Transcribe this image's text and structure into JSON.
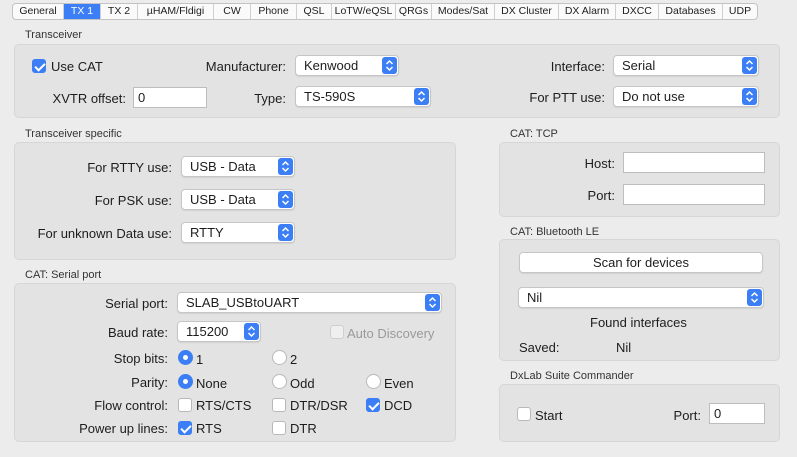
{
  "tabs": [
    "General",
    "TX 1",
    "TX 2",
    "µHAM/Fldigi",
    "CW",
    "Phone",
    "QSL",
    "LoTW/eQSL",
    "QRGs",
    "Modes/Sat",
    "DX Cluster",
    "DX Alarm",
    "DXCC",
    "Databases",
    "UDP"
  ],
  "selected_tab": "TX 1",
  "transceiver": {
    "title": "Transceiver",
    "use_cat_label": "Use CAT",
    "use_cat_checked": true,
    "manufacturer_label": "Manufacturer:",
    "manufacturer_value": "Kenwood",
    "interface_label": "Interface:",
    "interface_value": "Serial",
    "xvtr_label": "XVTR offset:",
    "xvtr_value": "0",
    "type_label": "Type:",
    "type_value": "TS-590S",
    "ptt_label": "For PTT use:",
    "ptt_value": "Do not use"
  },
  "specific": {
    "title": "Transceiver specific",
    "rtty_label": "For RTTY use:",
    "rtty_value": "USB - Data",
    "psk_label": "For PSK use:",
    "psk_value": "USB - Data",
    "unknown_label": "For unknown Data use:",
    "unknown_value": "RTTY"
  },
  "serial": {
    "title": "CAT: Serial port",
    "port_label": "Serial port:",
    "port_value": "SLAB_USBtoUART",
    "baud_label": "Baud rate:",
    "baud_value": "115200",
    "auto_discovery_label": "Auto Discovery",
    "stop_bits_label": "Stop bits:",
    "stop_bits_options": [
      "1",
      "2"
    ],
    "stop_bits_selected": "1",
    "parity_label": "Parity:",
    "parity_options": [
      "None",
      "Odd",
      "Even"
    ],
    "parity_selected": "None",
    "flow_label": "Flow control:",
    "flow_options": [
      "RTS/CTS",
      "DTR/DSR",
      "DCD"
    ],
    "flow_checked": [
      "DCD"
    ],
    "power_label": "Power up lines:",
    "power_options": [
      "RTS",
      "DTR"
    ],
    "power_checked": [
      "RTS"
    ]
  },
  "tcp": {
    "title": "CAT: TCP",
    "host_label": "Host:",
    "host_value": "",
    "port_label": "Port:",
    "port_value": ""
  },
  "bluetooth": {
    "title": "CAT: Bluetooth LE",
    "scan_button": "Scan for devices",
    "device_value": "Nil",
    "found_label": "Found interfaces",
    "saved_label": "Saved:",
    "saved_value": "Nil"
  },
  "dxlab": {
    "title": "DxLab Suite Commander",
    "start_label": "Start",
    "start_checked": false,
    "port_label": "Port:",
    "port_value": "0"
  },
  "colors": {
    "accent": "#3b7ef6",
    "background": "#ececec",
    "group_box": "#e3e3e3"
  }
}
